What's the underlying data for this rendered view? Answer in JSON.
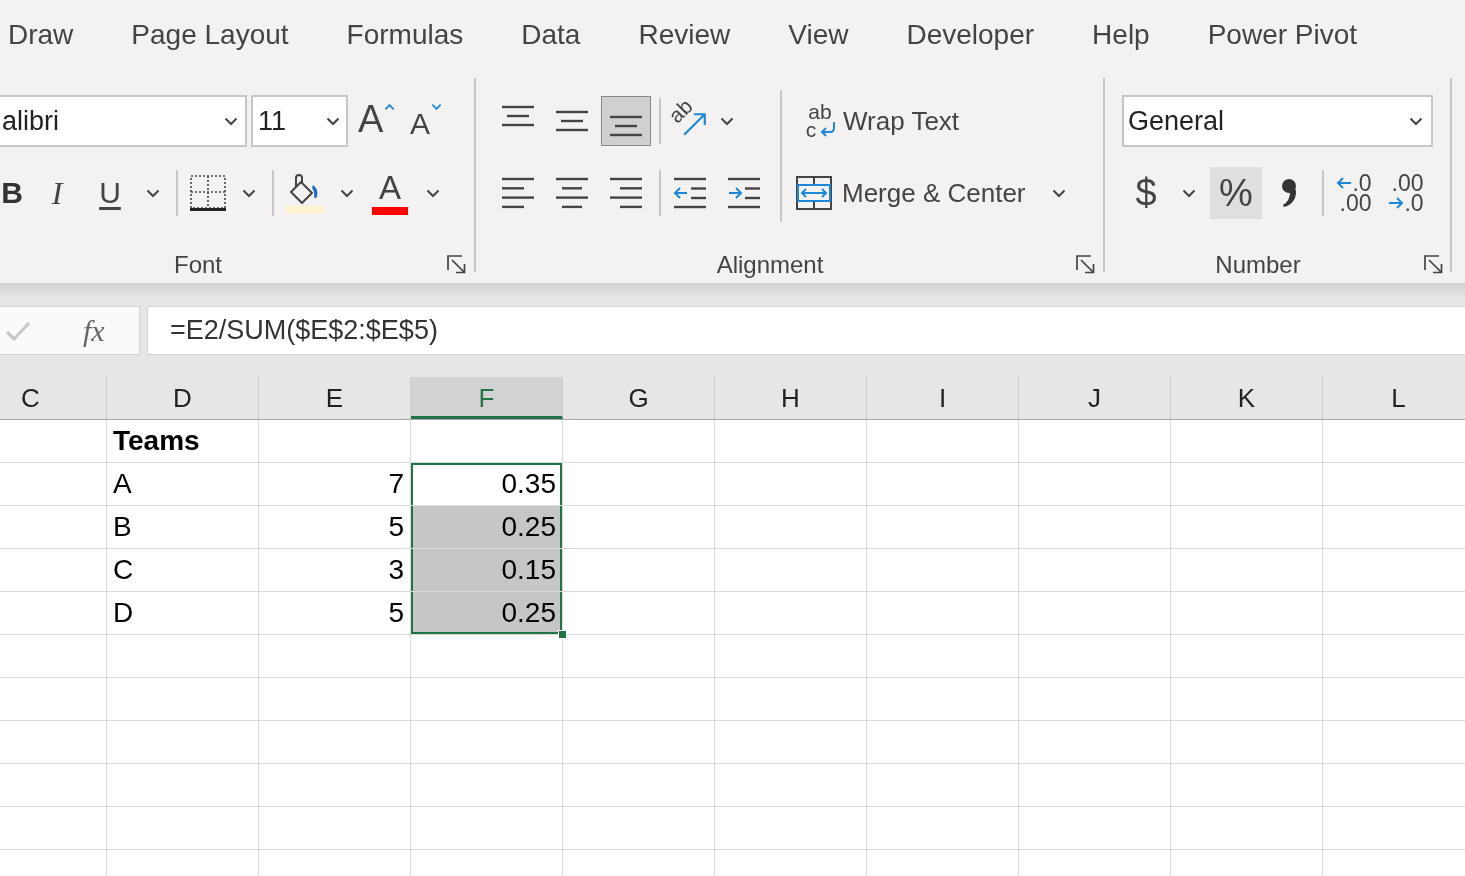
{
  "ribbon_tabs": [
    "Draw",
    "Page Layout",
    "Formulas",
    "Data",
    "Review",
    "View",
    "Developer",
    "Help",
    "Power Pivot"
  ],
  "font_group": {
    "font_name": "alibri",
    "font_size": "11",
    "grow_font": "A",
    "shrink_font": "A",
    "bold": "B",
    "italic": "I",
    "underline": "U",
    "font_color": "A",
    "label": "Font"
  },
  "alignment_group": {
    "vertical_align": [
      {
        "kind": "top",
        "selected": false
      },
      {
        "kind": "middle",
        "selected": false
      },
      {
        "kind": "bottom",
        "selected": true
      }
    ],
    "orientation": "ab",
    "horizontal_align": [
      {
        "kind": "left",
        "selected": false
      },
      {
        "kind": "center",
        "selected": false
      },
      {
        "kind": "right",
        "selected": false
      }
    ],
    "wrap_text_icon": [
      "ab",
      "c"
    ],
    "wrap_text": "Wrap Text",
    "merge_center": "Merge & Center",
    "label": "Alignment"
  },
  "number_group": {
    "format": "General",
    "buttons": [
      {
        "kind": "currency",
        "label": "$",
        "selected": false
      },
      {
        "kind": "percent",
        "label": "%",
        "selected": true
      },
      {
        "kind": "comma",
        "selected": false
      },
      {
        "kind": "increase_decimal",
        "lines": [
          ".0",
          ".00"
        ],
        "selected": false
      },
      {
        "kind": "decrease_decimal",
        "lines": [
          ".00",
          ".0"
        ],
        "selected": false
      }
    ],
    "label": "Number"
  },
  "formula_bar": {
    "enter_disabled": true,
    "function_label": "fx",
    "formula": "=E2/SUM($E$2:$E$5)"
  },
  "sheet": {
    "columns": [
      {
        "label": "C",
        "selected": false
      },
      {
        "label": "D",
        "selected": false
      },
      {
        "label": "E",
        "selected": false
      },
      {
        "label": "F",
        "selected": true
      },
      {
        "label": "G",
        "selected": false
      },
      {
        "label": "H",
        "selected": false
      },
      {
        "label": "I",
        "selected": false
      },
      {
        "label": "J",
        "selected": false
      },
      {
        "label": "K",
        "selected": false
      },
      {
        "label": "L",
        "selected": false
      }
    ],
    "rows": [
      {
        "kind": "header",
        "column_d": "Teams",
        "f_selected": false,
        "f_active": false
      },
      {
        "kind": "data",
        "column_d": "A",
        "column_e": "7",
        "column_f": "0.35",
        "f_selected": true,
        "f_active": true
      },
      {
        "kind": "data",
        "column_d": "B",
        "column_e": "5",
        "column_f": "0.25",
        "f_selected": true,
        "f_active": false
      },
      {
        "kind": "data",
        "column_d": "C",
        "column_e": "3",
        "column_f": "0.15",
        "f_selected": true,
        "f_active": false
      },
      {
        "kind": "data",
        "column_d": "D",
        "column_e": "5",
        "column_f": "0.25",
        "f_selected": true,
        "f_active": false
      }
    ]
  }
}
